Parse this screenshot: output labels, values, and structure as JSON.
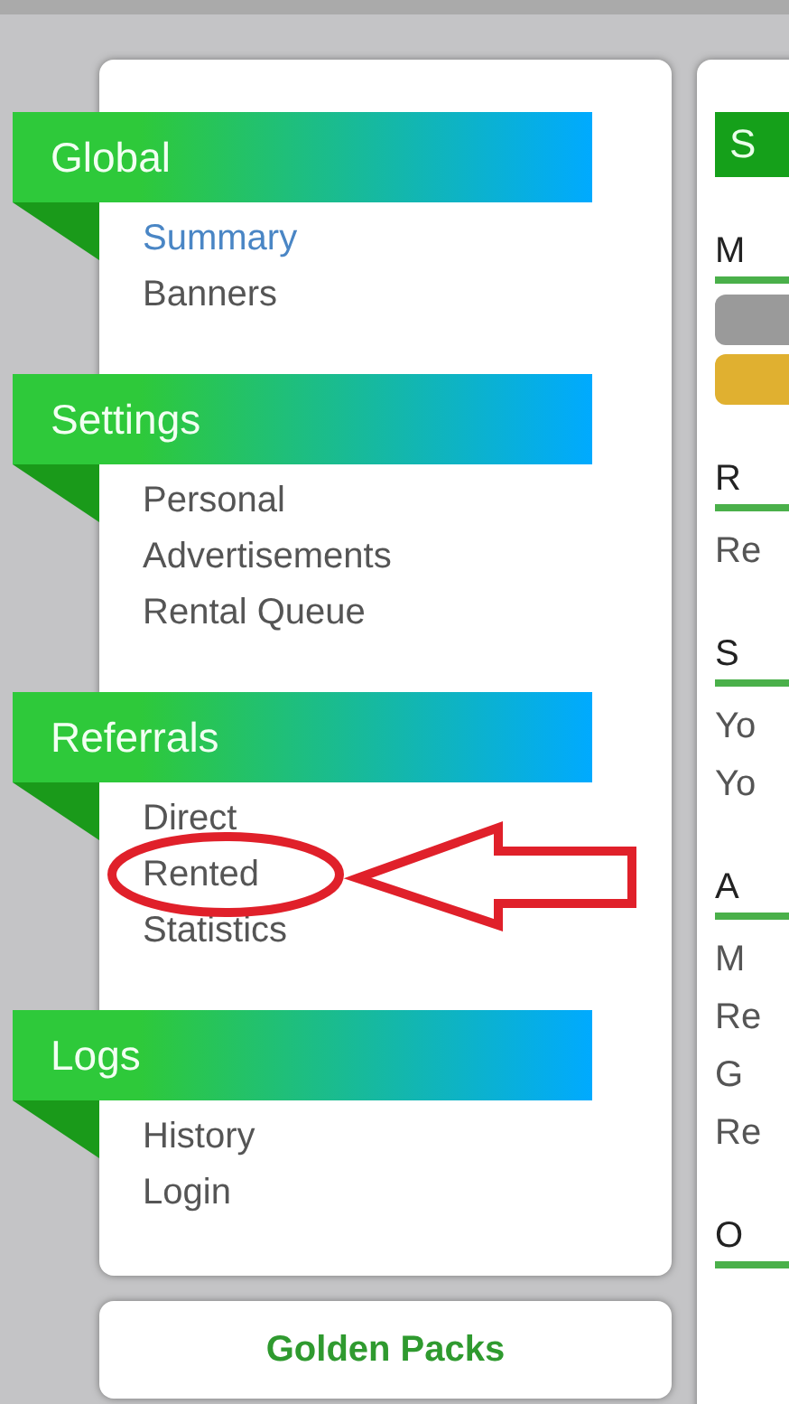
{
  "menu": [
    {
      "title": "Global",
      "items": [
        {
          "label": "Summary",
          "selected": true
        },
        {
          "label": "Banners",
          "selected": false
        }
      ]
    },
    {
      "title": "Settings",
      "items": [
        {
          "label": "Personal",
          "selected": false
        },
        {
          "label": "Advertisements",
          "selected": false
        },
        {
          "label": "Rental Queue",
          "selected": false
        }
      ]
    },
    {
      "title": "Referrals",
      "items": [
        {
          "label": "Direct",
          "selected": false
        },
        {
          "label": "Rented",
          "selected": false
        },
        {
          "label": "Statistics",
          "selected": false
        }
      ]
    },
    {
      "title": "Logs",
      "items": [
        {
          "label": "History",
          "selected": false
        },
        {
          "label": "Login",
          "selected": false
        }
      ]
    }
  ],
  "golden_packs": "Golden Packs",
  "content": {
    "badge": "S",
    "sections": [
      {
        "heading": "M",
        "bars": [
          {
            "color": "#9a9a9a"
          },
          {
            "color": "#e0b030"
          }
        ]
      },
      {
        "heading": "R",
        "lines": [
          "Re"
        ]
      },
      {
        "heading": "S",
        "lines": [
          "Yo",
          "Yo"
        ]
      },
      {
        "heading": "A",
        "lines": [
          "M",
          "Re",
          "G",
          "Re"
        ]
      },
      {
        "heading": "O"
      }
    ]
  }
}
